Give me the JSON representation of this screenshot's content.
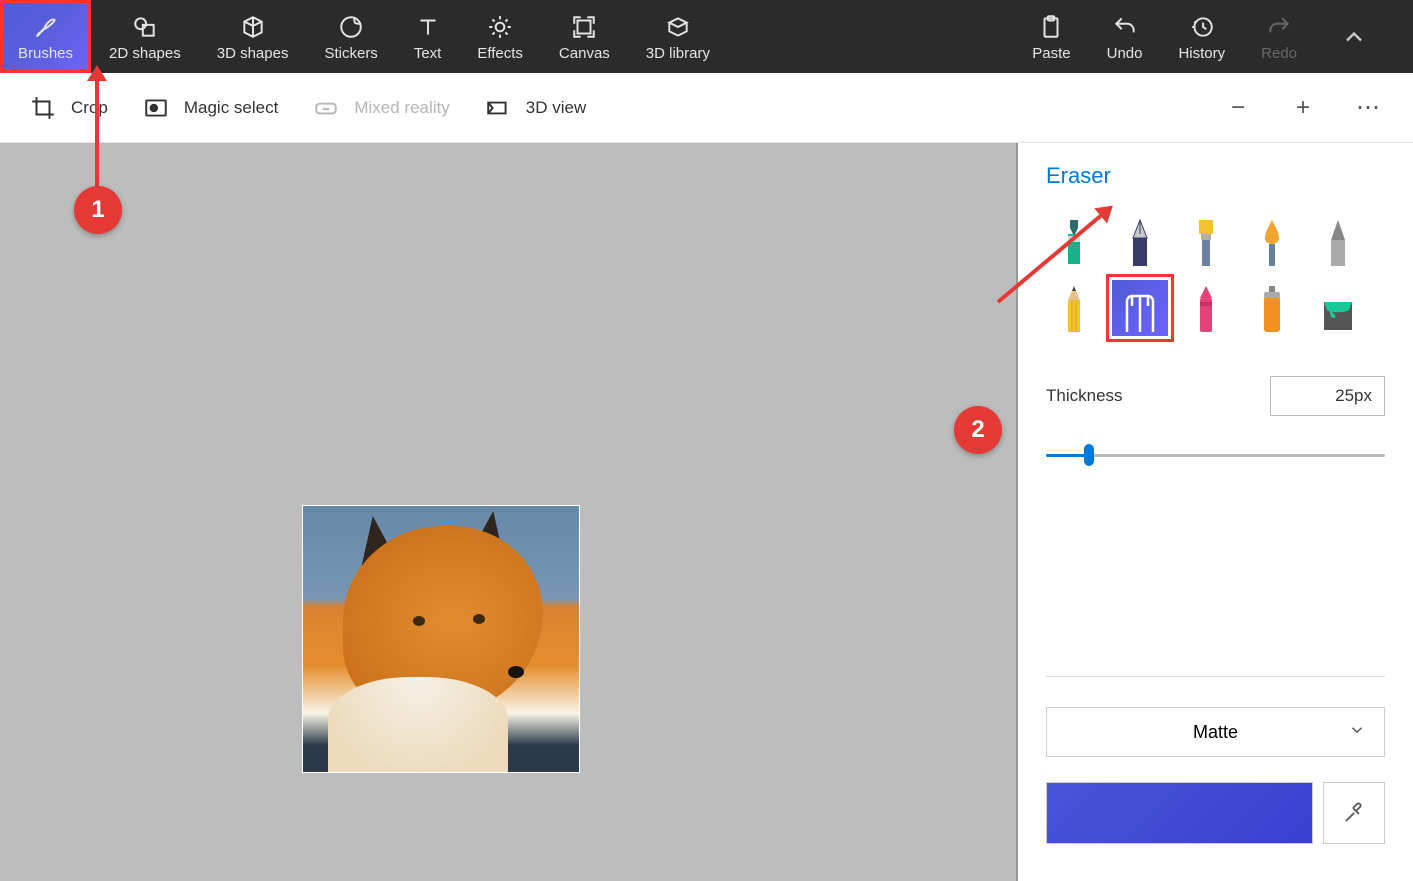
{
  "top_tabs": {
    "brushes": "Brushes",
    "shapes2d": "2D shapes",
    "shapes3d": "3D shapes",
    "stickers": "Stickers",
    "text": "Text",
    "effects": "Effects",
    "canvas": "Canvas",
    "library3d": "3D library",
    "paste": "Paste",
    "undo": "Undo",
    "history": "History",
    "redo": "Redo"
  },
  "sub_tools": {
    "crop": "Crop",
    "magic_select": "Magic select",
    "mixed_reality": "Mixed reality",
    "view3d": "3D view"
  },
  "panel": {
    "title": "Eraser",
    "thickness_label": "Thickness",
    "thickness_value": "25px",
    "material": "Matte"
  },
  "tools": {
    "marker": "marker",
    "calligraphy_pen": "calligraphy-pen",
    "oil_brush": "oil-brush",
    "watercolor": "watercolor",
    "pixel_pen": "pixel-pen",
    "pencil": "pencil",
    "eraser": "eraser",
    "crayon": "crayon",
    "spray_can": "spray-can",
    "fill": "fill"
  },
  "annotations": {
    "a1": "1",
    "a2": "2"
  },
  "colors": {
    "accent": "#0078d7",
    "selected_gradient_from": "#4f5bd5",
    "selected_gradient_to": "#6c63ff",
    "annotation": "#e53935"
  }
}
